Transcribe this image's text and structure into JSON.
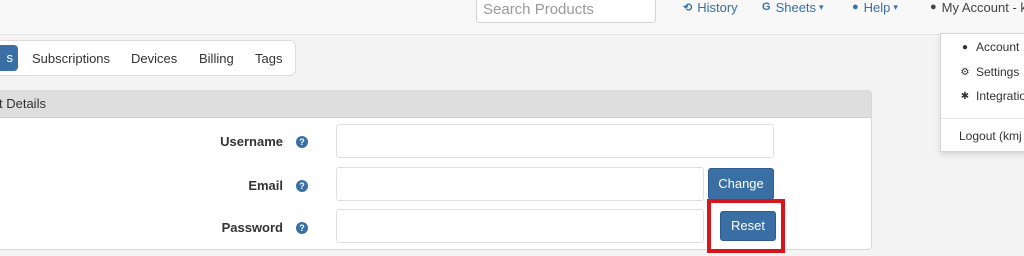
{
  "navbar": {
    "search_placeholder": "Search Products",
    "history": "History",
    "sheets": "Sheets",
    "help": "Help",
    "account": "My Account - k",
    "history_icon": "history-icon",
    "sheets_icon": "google-g-icon",
    "help_icon": "info-circle-icon",
    "account_icon": "user-icon"
  },
  "tabs": [
    "s",
    "Subscriptions",
    "Devices",
    "Billing",
    "Tags"
  ],
  "panel": {
    "heading": "t Details",
    "fields": {
      "username": {
        "label": "Username",
        "value": ""
      },
      "email": {
        "label": "Email",
        "value": "",
        "button": "Change"
      },
      "password": {
        "label": "Password",
        "value": "",
        "button": "Reset"
      }
    }
  },
  "account_menu": {
    "items": [
      "Account",
      "Settings",
      "Integratio"
    ],
    "logout": "Logout (kmj"
  },
  "colors": {
    "primary": "#3a6fa6",
    "highlight": "#d6151d",
    "panel_heading": "#dedede"
  }
}
